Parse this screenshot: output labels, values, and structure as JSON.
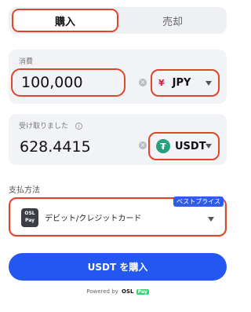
{
  "tabs": {
    "buy_label": "購入",
    "sell_label": "売却"
  },
  "spend": {
    "label": "消費",
    "amount": "100,000",
    "currency_code": "JPY",
    "currency_symbol": "¥"
  },
  "receive": {
    "label": "受け取りました",
    "info_glyph": "i",
    "amount": "628.4415",
    "currency_code": "USDT",
    "currency_symbol": "₮"
  },
  "payment": {
    "section_label": "支払方法",
    "badge": "ベストプライス",
    "method": "デビット/クレジットカード",
    "logo_top": "OSL",
    "logo_bottom": "Pay"
  },
  "cta": {
    "label": "USDT を購入"
  },
  "footer": {
    "powered_by": "Powered by",
    "brand": "OSL",
    "brand_suffix": "Pay"
  },
  "colors": {
    "accent": "#2457f0",
    "highlight_outline": "#e0452b",
    "tether": "#26a17b"
  }
}
